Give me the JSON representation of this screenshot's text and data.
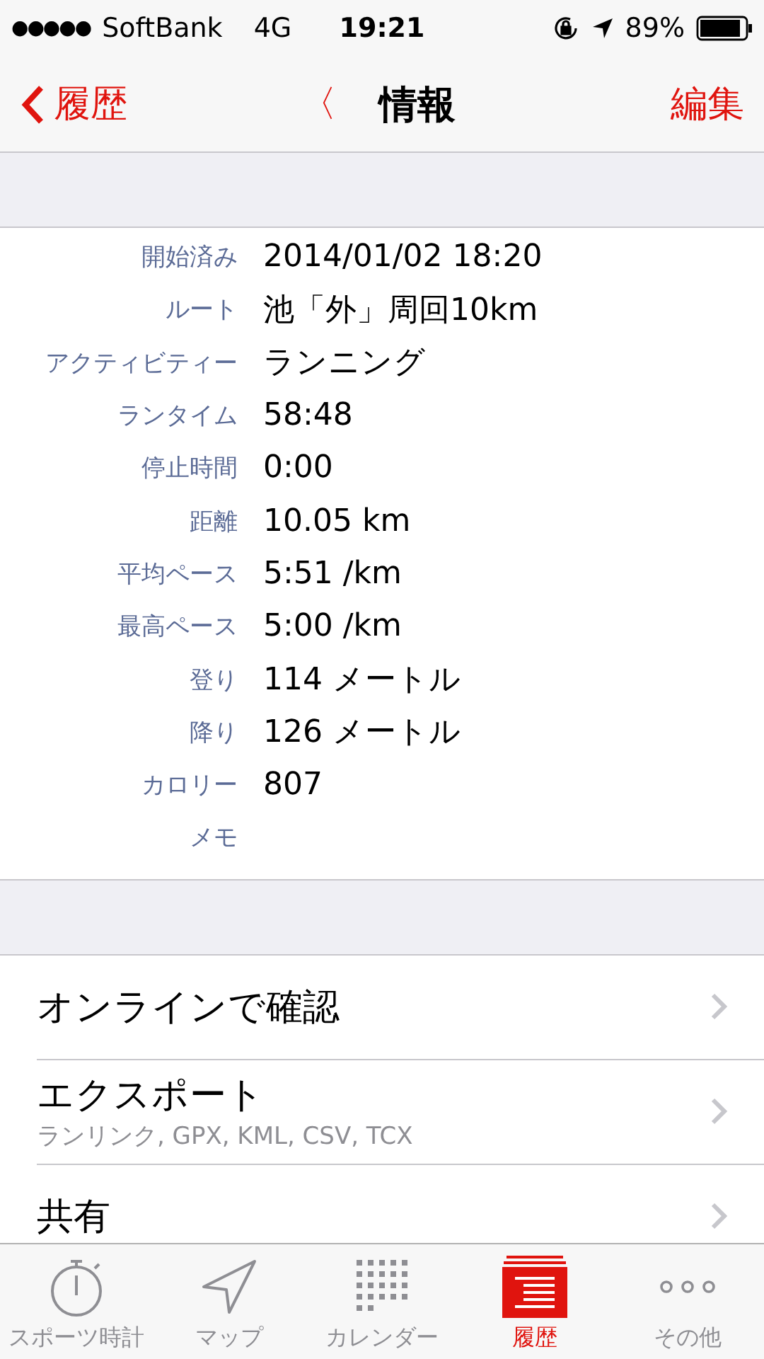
{
  "status_bar": {
    "signal_dots": "●●●●●",
    "carrier": "SoftBank",
    "network": "4G",
    "time": "19:21",
    "battery": "89%"
  },
  "nav": {
    "back": "履歴",
    "prev": "〈",
    "title": "情報",
    "edit": "編集"
  },
  "details": [
    {
      "label": "開始済み",
      "value": "2014/01/02 18:20"
    },
    {
      "label": "ルート",
      "value": "池「外」周回10km"
    },
    {
      "label": "アクティビティー",
      "value": "ランニング"
    },
    {
      "label": "ランタイム",
      "value": "58:48"
    },
    {
      "label": "停止時間",
      "value": "0:00"
    },
    {
      "label": "距離",
      "value": "10.05 km"
    },
    {
      "label": "平均ペース",
      "value": "5:51 /km"
    },
    {
      "label": "最高ペース",
      "value": "5:00 /km"
    },
    {
      "label": "登り",
      "value": "114 メートル"
    },
    {
      "label": "降り",
      "value": "126 メートル"
    },
    {
      "label": "カロリー",
      "value": "807"
    },
    {
      "label": "メモ"
    }
  ],
  "actions": [
    {
      "title": "オンラインで確認"
    },
    {
      "title": "エクスポート",
      "subtitle": "ランリンク, GPX, KML, CSV, TCX"
    },
    {
      "title": "共有"
    }
  ],
  "tabs": [
    {
      "label": "スポーツ時計",
      "kind": "stopwatch",
      "selected": false
    },
    {
      "label": "マップ",
      "kind": "location",
      "selected": false
    },
    {
      "label": "カレンダー",
      "kind": "calendar",
      "selected": false
    },
    {
      "label": "履歴",
      "kind": "history",
      "selected": true
    },
    {
      "label": "その他",
      "kind": "more",
      "selected": false
    }
  ]
}
